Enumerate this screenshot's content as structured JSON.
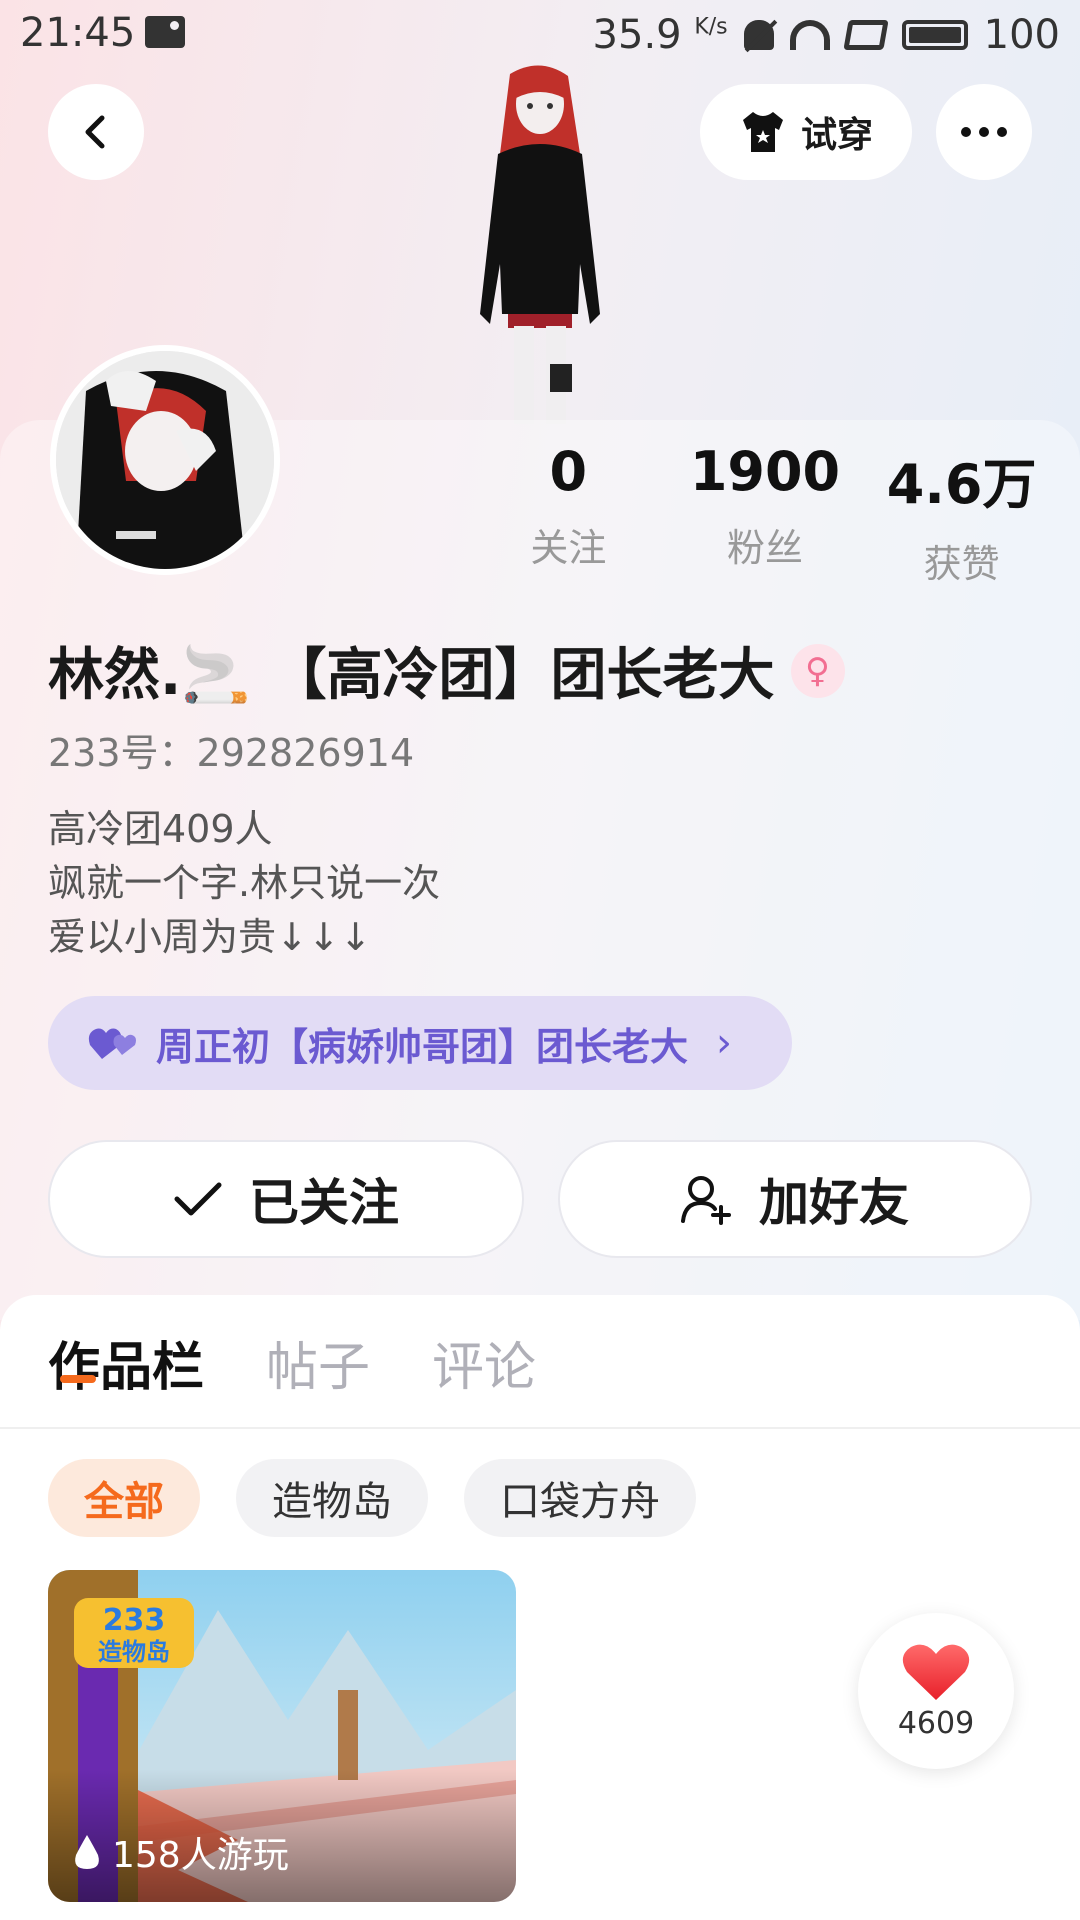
{
  "status_bar": {
    "time": "21:45",
    "speed": "35.9",
    "speed_unit": "K/s",
    "battery": "100"
  },
  "header": {
    "try_on_label": "试穿"
  },
  "stats": [
    {
      "value": "0",
      "label": "关注"
    },
    {
      "value": "1900",
      "label": "粉丝"
    },
    {
      "value": "4.6万",
      "label": "获赞"
    }
  ],
  "profile": {
    "name": "林然.🚬 【高冷团】团长老大",
    "gender_symbol": "♀",
    "uid": "233号：292826914",
    "bio": [
      "高冷团409人",
      "飒就一个字.林只说一次",
      "爱以小周为贵↓↓↓"
    ],
    "relation": "周正初【病娇帅哥团】团长老大"
  },
  "actions": {
    "follow_label": "已关注",
    "add_friend_label": "加好友"
  },
  "tabs": [
    {
      "label": "作品栏",
      "active": true
    },
    {
      "label": "帖子",
      "active": false
    },
    {
      "label": "评论",
      "active": false
    }
  ],
  "filters": [
    {
      "label": "全部",
      "active": true
    },
    {
      "label": "造物岛",
      "active": false
    },
    {
      "label": "口袋方舟",
      "active": false
    }
  ],
  "game_card": {
    "logo_text": "233造物岛",
    "plays": "158人游玩"
  },
  "like": {
    "count": "4609"
  },
  "colors": {
    "accent": "#f56a1d",
    "relation_text": "#6b5ad1",
    "gender": "#f26f92"
  }
}
